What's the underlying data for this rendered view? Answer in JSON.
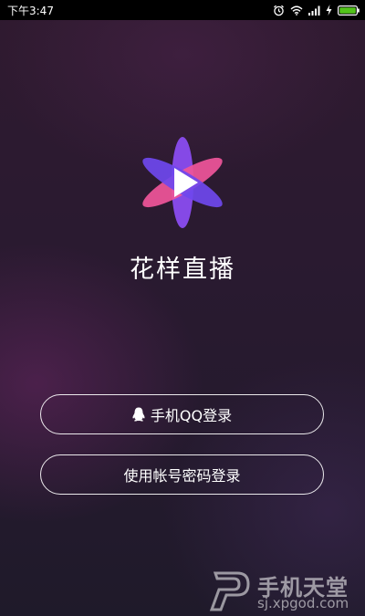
{
  "status_bar": {
    "time": "下午3:47",
    "icons": [
      "alarm-icon",
      "wifi-icon",
      "signal-icon",
      "charging-icon",
      "battery-icon"
    ]
  },
  "app": {
    "name": "花样直播",
    "logo_colors": {
      "pink": "#f0559a",
      "purple": "#7a4ff0",
      "white": "#ffffff"
    }
  },
  "buttons": {
    "qq_login": {
      "label": "手机QQ登录",
      "icon": "qq-penguin-icon"
    },
    "account_login": {
      "label": "使用帐号密码登录"
    }
  },
  "watermark": {
    "title": "手机天堂",
    "url": "sj.xpgod.com"
  }
}
